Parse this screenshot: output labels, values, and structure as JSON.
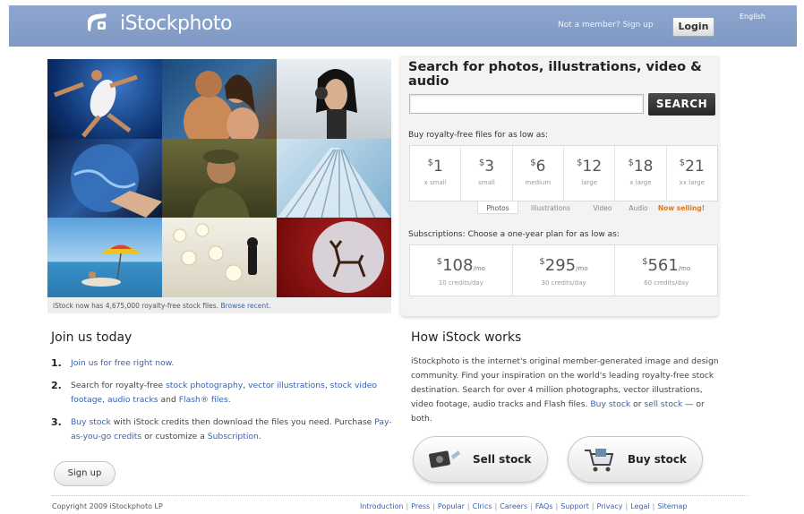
{
  "header": {
    "brand": "iStockphoto",
    "not_member": "Not a member? Sign up",
    "login": "Login",
    "language": "English"
  },
  "hero": {
    "caption_prefix": "iStock now has 4,675,000 royalty-free stock files.",
    "caption_link": "Browse recent."
  },
  "search": {
    "title": "Search for photos, illustrations, video & audio",
    "placeholder": "",
    "button": "SEARCH",
    "buy_label": "Buy royalty-free files for as low as:",
    "prices": [
      {
        "amount": "1",
        "size": "x small"
      },
      {
        "amount": "3",
        "size": "small"
      },
      {
        "amount": "6",
        "size": "medium"
      },
      {
        "amount": "12",
        "size": "large"
      },
      {
        "amount": "18",
        "size": "x large"
      },
      {
        "amount": "21",
        "size": "xx large"
      }
    ],
    "tabs": [
      "Photos",
      "Illustrations",
      "Video",
      "Audio",
      "Now selling!"
    ],
    "subs_label": "Subscriptions: Choose a one-year plan for as low as:",
    "subscriptions": [
      {
        "amount": "108",
        "per": "/mo",
        "credits": "10 credits/day"
      },
      {
        "amount": "295",
        "per": "/mo",
        "credits": "30 credits/day"
      },
      {
        "amount": "561",
        "per": "/mo",
        "credits": "60 credits/day"
      }
    ]
  },
  "join": {
    "title": "Join us today",
    "step1_link": "Join us for free right now.",
    "step2_a": "Search for royalty-free ",
    "step2_link1": "stock photography",
    "step2_b": ", ",
    "step2_link2": "vector illustrations",
    "step2_c": ", ",
    "step2_link3": "stock video footage",
    "step2_d": ", ",
    "step2_link4": "audio tracks",
    "step2_e": " and ",
    "step2_link5": "Flash® files",
    "step2_f": ".",
    "step3_link1": "Buy stock",
    "step3_a": " with iStock credits then download the files you need. Purchase ",
    "step3_link2": "Pay-as-you-go credits",
    "step3_b": " or customize a ",
    "step3_link3": "Subscription",
    "step3_c": ".",
    "signup": "Sign up"
  },
  "how": {
    "title": "How iStock works",
    "text": "iStockphoto is the internet's original member-generated image and design community. Find your inspiration on the world's leading royalty-free stock destination. Search for over 4 million photographs, vector illustrations, video footage, audio tracks and Flash files. ",
    "link1": "Buy stock",
    "mid": " or ",
    "link2": "sell stock",
    "end": " — or both.",
    "sell_button": "Sell stock",
    "buy_button": "Buy stock"
  },
  "footer": {
    "copyright": "Copyright 2009 iStockphoto LP",
    "links": [
      "Introduction",
      "Press",
      "Popular",
      "Clrics",
      "Careers",
      "FAQs",
      "Support",
      "Privacy",
      "Legal",
      "Sitemap"
    ]
  },
  "colors": {
    "header_bg": "#8ea6cf",
    "link": "#3a62b0",
    "accent": "#e07a1e"
  }
}
